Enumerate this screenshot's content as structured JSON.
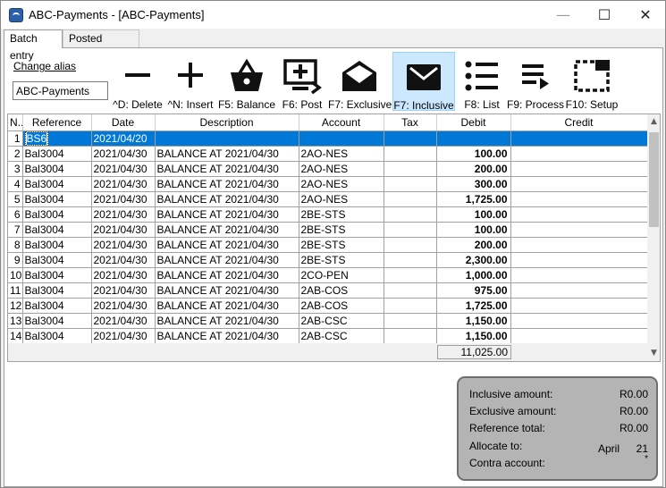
{
  "window": {
    "title": "ABC-Payments - [ABC-Payments]",
    "controls": {
      "minimize": "—",
      "maximize": "☐",
      "close": "✕"
    }
  },
  "tabs": [
    {
      "label": "Batch entry",
      "active": true
    },
    {
      "label": "Posted batches",
      "active": false
    }
  ],
  "alias": {
    "label": "Change alias",
    "value": "ABC-Payments"
  },
  "toolbar": {
    "delete": "^D: Delete",
    "insert": "^N: Insert",
    "balance": "F5: Balance",
    "post": "F6: Post",
    "exclusive": "F7: Exclusive",
    "inclusive": "F7: Inclusive",
    "list": "F8: List",
    "process": "F9: Process",
    "setup": "F10: Setup"
  },
  "grid": {
    "columns": [
      "N...",
      "Reference",
      "Date",
      "Description",
      "Account",
      "Tax",
      "Debit",
      "Credit"
    ],
    "rows": [
      {
        "n": "1",
        "reference": "BS6",
        "date": "2021/04/20",
        "description": "",
        "account": "",
        "tax": "",
        "debit": "",
        "credit": "",
        "selected": true
      },
      {
        "n": "2",
        "reference": "Bal3004",
        "date": "2021/04/30",
        "description": "BALANCE AT 2021/04/30",
        "account": "2AO-NES",
        "tax": "",
        "debit": "100.00",
        "credit": ""
      },
      {
        "n": "3",
        "reference": "Bal3004",
        "date": "2021/04/30",
        "description": "BALANCE AT 2021/04/30",
        "account": "2AO-NES",
        "tax": "",
        "debit": "200.00",
        "credit": ""
      },
      {
        "n": "4",
        "reference": "Bal3004",
        "date": "2021/04/30",
        "description": "BALANCE AT 2021/04/30",
        "account": "2AO-NES",
        "tax": "",
        "debit": "300.00",
        "credit": ""
      },
      {
        "n": "5",
        "reference": "Bal3004",
        "date": "2021/04/30",
        "description": "BALANCE AT 2021/04/30",
        "account": "2AO-NES",
        "tax": "",
        "debit": "1,725.00",
        "credit": ""
      },
      {
        "n": "6",
        "reference": "Bal3004",
        "date": "2021/04/30",
        "description": "BALANCE AT 2021/04/30",
        "account": "2BE-STS",
        "tax": "",
        "debit": "100.00",
        "credit": ""
      },
      {
        "n": "7",
        "reference": "Bal3004",
        "date": "2021/04/30",
        "description": "BALANCE AT 2021/04/30",
        "account": "2BE-STS",
        "tax": "",
        "debit": "100.00",
        "credit": ""
      },
      {
        "n": "8",
        "reference": "Bal3004",
        "date": "2021/04/30",
        "description": "BALANCE AT 2021/04/30",
        "account": "2BE-STS",
        "tax": "",
        "debit": "200.00",
        "credit": ""
      },
      {
        "n": "9",
        "reference": "Bal3004",
        "date": "2021/04/30",
        "description": "BALANCE AT 2021/04/30",
        "account": "2BE-STS",
        "tax": "",
        "debit": "2,300.00",
        "credit": ""
      },
      {
        "n": "10",
        "reference": "Bal3004",
        "date": "2021/04/30",
        "description": "BALANCE AT 2021/04/30",
        "account": "2CO-PEN",
        "tax": "",
        "debit": "1,000.00",
        "credit": ""
      },
      {
        "n": "11",
        "reference": "Bal3004",
        "date": "2021/04/30",
        "description": "BALANCE AT 2021/04/30",
        "account": "2AB-COS",
        "tax": "",
        "debit": "975.00",
        "credit": ""
      },
      {
        "n": "12",
        "reference": "Bal3004",
        "date": "2021/04/30",
        "description": "BALANCE AT 2021/04/30",
        "account": "2AB-COS",
        "tax": "",
        "debit": "1,725.00",
        "credit": ""
      },
      {
        "n": "13",
        "reference": "Bal3004",
        "date": "2021/04/30",
        "description": "BALANCE AT 2021/04/30",
        "account": "2AB-CSC",
        "tax": "",
        "debit": "1,150.00",
        "credit": ""
      },
      {
        "n": "14",
        "reference": "Bal3004",
        "date": "2021/04/30",
        "description": "BALANCE AT 2021/04/30",
        "account": "2AB-CSC",
        "tax": "",
        "debit": "1,150.00",
        "credit": ""
      }
    ],
    "debit_total": "11,025.00"
  },
  "summary": {
    "inclusive_label": "Inclusive amount:",
    "inclusive_value": "R0.00",
    "exclusive_label": "Exclusive amount:",
    "exclusive_value": "R0.00",
    "reference_label": "Reference total:",
    "reference_value": "R0.00",
    "allocate_label": "Allocate to:",
    "allocate_month": "April",
    "allocate_period": "21",
    "contra_label": "Contra account:",
    "contra_value": "*"
  },
  "colors": {
    "selection": "#0078d7",
    "toolbar_active": "#cce8ff",
    "summary_bg": "#b4b4b4"
  }
}
